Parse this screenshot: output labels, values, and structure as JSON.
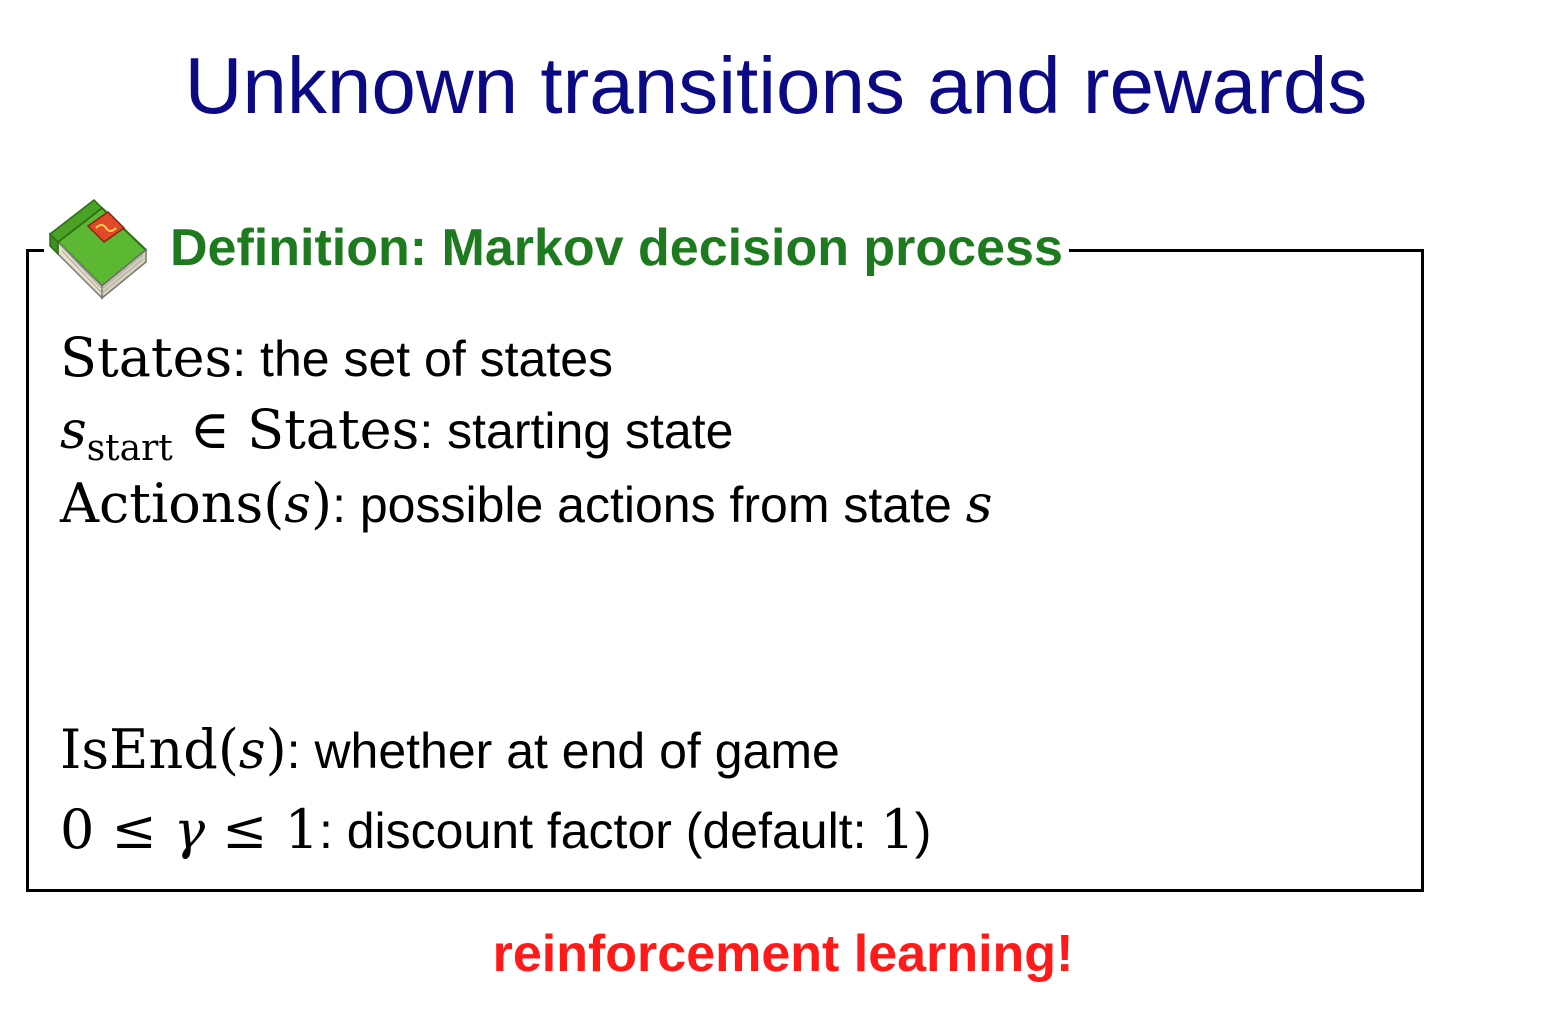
{
  "slide": {
    "title": "Unknown transitions and rewards"
  },
  "definition": {
    "icon": "book-icon",
    "title": "Definition: Markov decision process",
    "lines": [
      {
        "math": "States",
        "text": ": the set of states"
      },
      {
        "math_var": "s",
        "math_sub": "start",
        "math_op": " ∈ ",
        "math": "States",
        "text": ": starting state"
      },
      {
        "math": "Actions",
        "math_open": "(",
        "math_var": "s",
        "math_close": ")",
        "text": ": possible actions from state ",
        "trailing_var": "s"
      },
      {
        "math": "IsEnd",
        "math_open": "(",
        "math_var": "s",
        "math_close": ")",
        "text": ": whether at end of game"
      },
      {
        "math_pre": "0 ≤ ",
        "math_var": "γ",
        "math_post": " ≤ 1",
        "text": ": discount factor (default: ",
        "default_value": "1",
        "text_end": ")"
      }
    ]
  },
  "footer": {
    "note": "reinforcement learning!"
  },
  "colors": {
    "title": "#0b0a84",
    "definition_title": "#1e7a1e",
    "footer_note": "#ff1a1a",
    "book_cover": "#5cb832",
    "book_label": "#e04a2a"
  }
}
